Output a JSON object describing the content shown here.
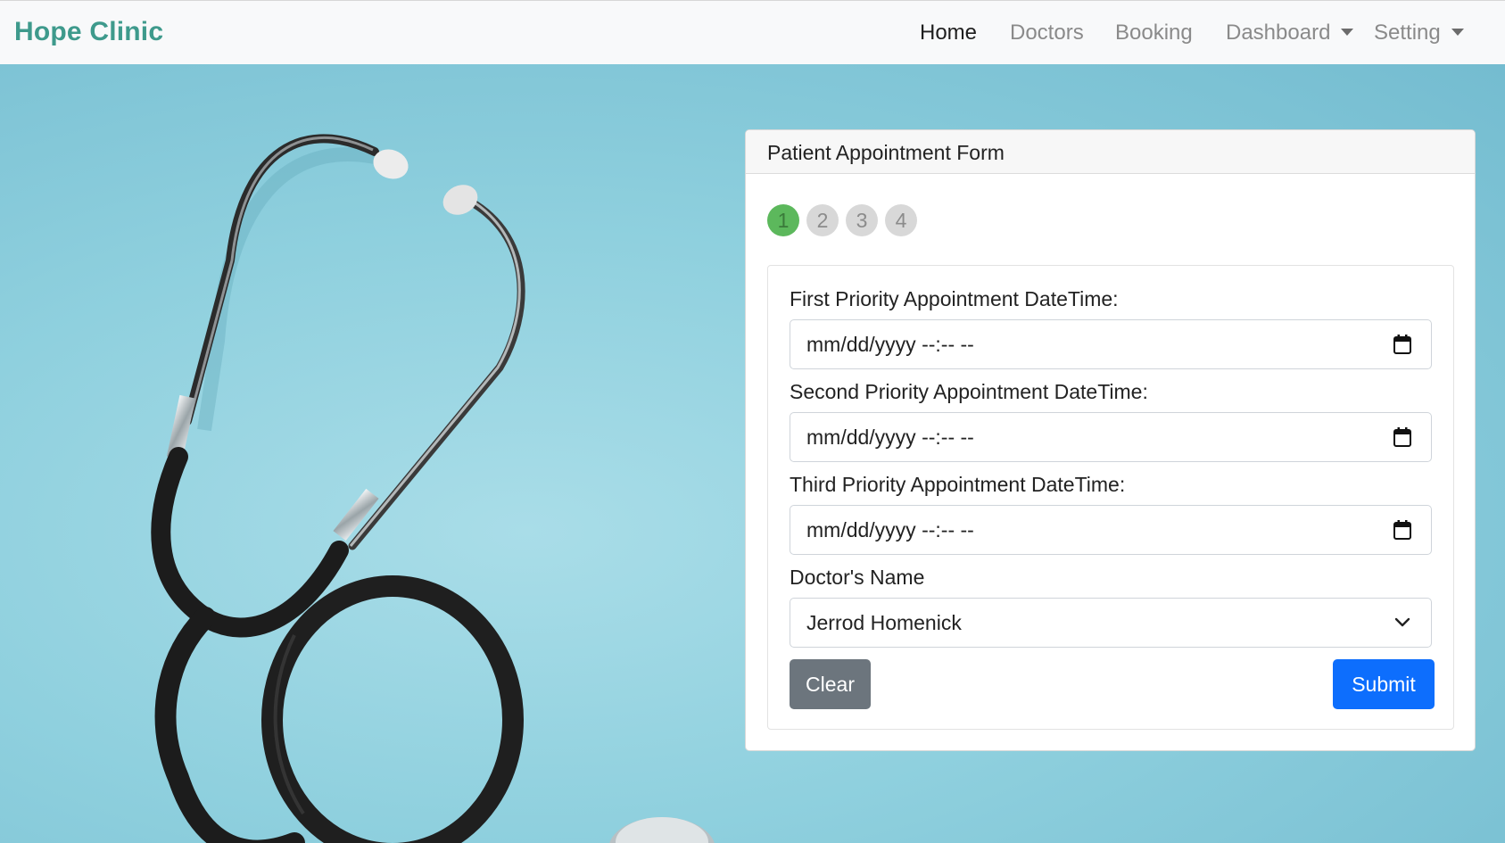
{
  "navbar": {
    "brand": "Hope Clinic",
    "items": [
      {
        "label": "Home",
        "active": true
      },
      {
        "label": "Doctors",
        "active": false
      },
      {
        "label": "Booking",
        "active": false
      },
      {
        "label": "Dashboard",
        "dropdown": true
      },
      {
        "label": "Setting",
        "dropdown": true
      }
    ]
  },
  "form": {
    "title": "Patient Appointment Form",
    "steps": [
      "1",
      "2",
      "3",
      "4"
    ],
    "active_step": "1",
    "fields": [
      {
        "label": "First Priority Appointment DateTime:",
        "value": "mm/dd/yyyy --:-- --",
        "icon": "calendar-icon"
      },
      {
        "label": "Second Priority Appointment DateTime:",
        "value": "mm/dd/yyyy --:-- --",
        "icon": "calendar-icon"
      },
      {
        "label": "Third Priority Appointment DateTime:",
        "value": "mm/dd/yyyy --:-- --",
        "icon": "calendar-icon"
      }
    ],
    "doctor": {
      "label": "Doctor's Name",
      "selected": "Jerrod Homenick",
      "icon": "chevron-down-icon"
    },
    "clear_label": "Clear",
    "submit_label": "Submit"
  },
  "colors": {
    "brand": "#3e9a8c",
    "step_active": "#5cb85c",
    "submit": "#0d6efd",
    "clear": "#6c757d",
    "background": "#8fcfdc"
  }
}
